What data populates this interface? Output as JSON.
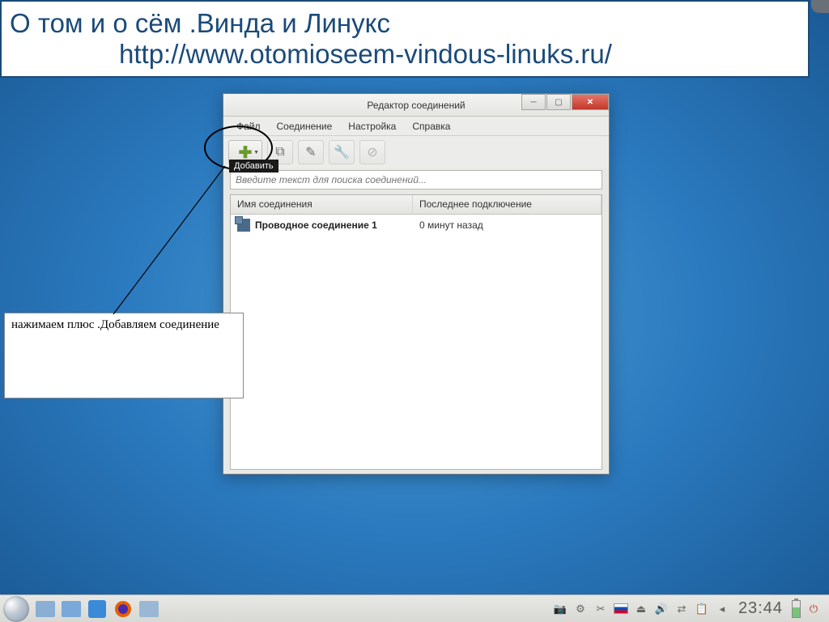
{
  "banner": {
    "title": "О том и о сём .Винда и Линукс",
    "url": "http://www.otomioseem-vindous-linuks.ru/"
  },
  "window": {
    "title": "Редактор соединений",
    "menu": {
      "file": "Файл",
      "connection": "Соединение",
      "settings": "Настройка",
      "help": "Справка"
    },
    "search_placeholder": "Введите текст для поиска соединений...",
    "columns": {
      "name": "Имя соединения",
      "last": "Последнее подключение"
    },
    "rows": [
      {
        "name": "Проводное соединение 1",
        "last": "0 минут назад"
      }
    ]
  },
  "tooltip": "Добавить",
  "note": "нажимаем плюс .Добавляем соединение",
  "taskbar": {
    "clock": "23:44"
  }
}
